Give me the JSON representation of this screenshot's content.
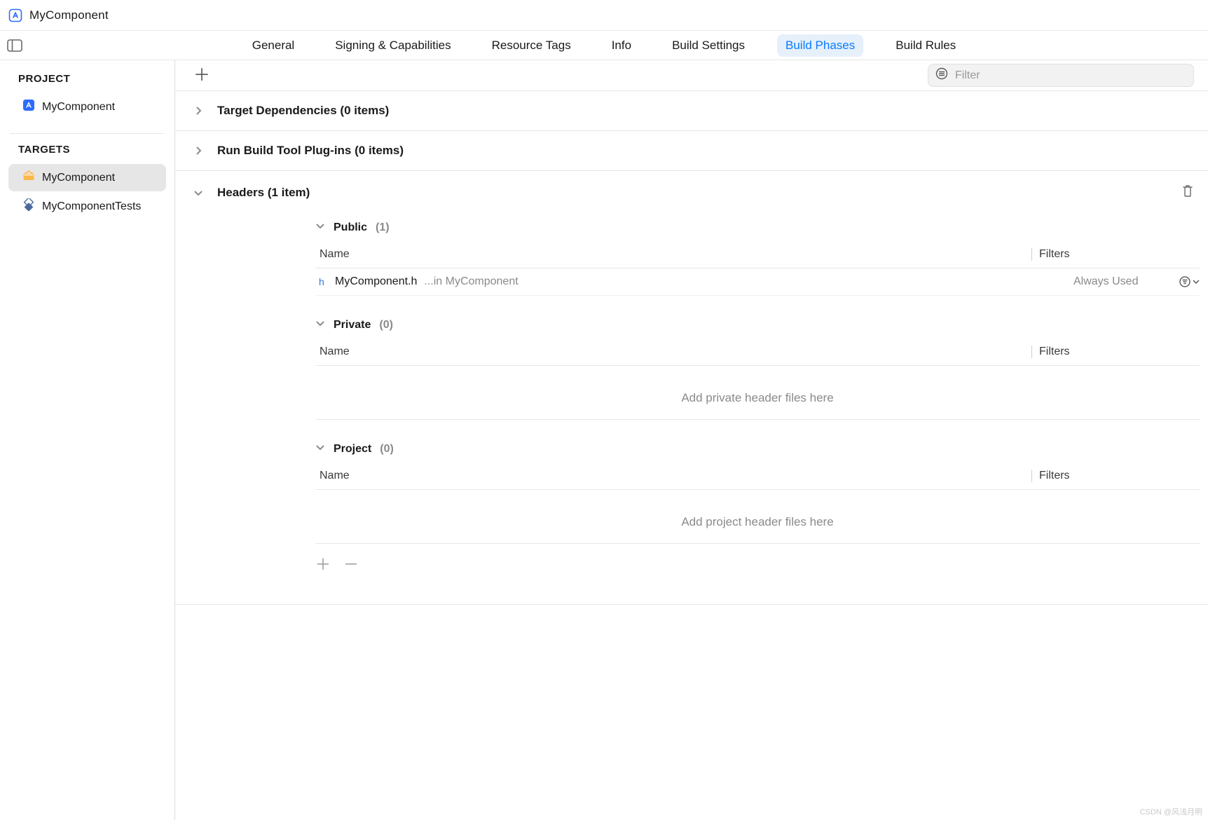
{
  "title": "MyComponent",
  "tabs": {
    "general": "General",
    "signing": "Signing & Capabilities",
    "resourceTags": "Resource Tags",
    "info": "Info",
    "buildSettings": "Build Settings",
    "buildPhases": "Build Phases",
    "buildRules": "Build Rules"
  },
  "sidebar": {
    "projectLabel": "PROJECT",
    "projectName": "MyComponent",
    "targetsLabel": "TARGETS",
    "targets": [
      {
        "name": "MyComponent"
      },
      {
        "name": "MyComponentTests"
      }
    ]
  },
  "filter": {
    "placeholder": "Filter"
  },
  "phases": {
    "targetDeps": {
      "title": "Target Dependencies",
      "count": "(0 items)"
    },
    "plugins": {
      "title": "Run Build Tool Plug-ins",
      "count": "(0 items)"
    },
    "headers": {
      "title": "Headers",
      "count": "(1 item)",
      "cols": {
        "name": "Name",
        "filters": "Filters"
      },
      "public": {
        "label": "Public",
        "count": "(1)",
        "rows": [
          {
            "file": "MyComponent.h",
            "path": "...in MyComponent",
            "filter": "Always Used"
          }
        ]
      },
      "private": {
        "label": "Private",
        "count": "(0)",
        "placeholder": "Add private header files here"
      },
      "project": {
        "label": "Project",
        "count": "(0)",
        "placeholder": "Add project header files here"
      }
    }
  },
  "watermark": "CSDN @风浅月明"
}
